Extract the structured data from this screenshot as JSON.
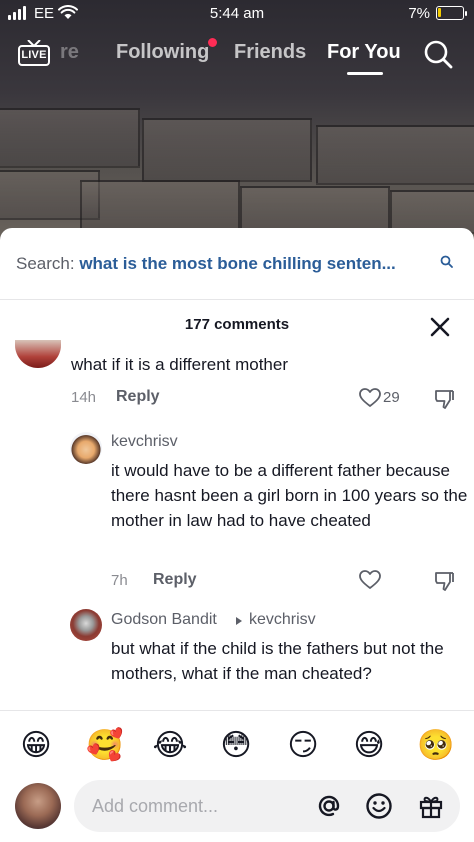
{
  "status": {
    "carrier": "EE",
    "time": "5:44 am",
    "battery": "7%"
  },
  "nav": {
    "live_label": "LIVE",
    "tabs": [
      {
        "label": "re"
      },
      {
        "label": "Following"
      },
      {
        "label": "Friends"
      },
      {
        "label": "For You"
      }
    ],
    "active_tab": "For You"
  },
  "search": {
    "label": "Search:",
    "query": "what is the most bone chilling senten..."
  },
  "comments_header": "177 comments",
  "comments": [
    {
      "text": "what if it is a different mother",
      "time": "14h",
      "reply_label": "Reply",
      "likes": "29"
    },
    {
      "username": "kevchrisv",
      "text": "it would have to be a different father because there hasnt been a girl born in 100 years so the mother in law had to have cheated",
      "time": "7h",
      "reply_label": "Reply"
    },
    {
      "username": "Godson Bandit",
      "reply_to": "kevchrisv",
      "text": "but what if the child is the fathers but not the mothers, what if the man cheated?"
    }
  ],
  "emojis": [
    "😁",
    "🥰",
    "😂",
    "😳",
    "😏",
    "😅",
    "🥺"
  ],
  "input": {
    "placeholder": "Add comment..."
  },
  "colors": {
    "accent_red": "#fe2c55",
    "search_query": "#2b5d98",
    "text_primary": "#161823",
    "text_secondary": "#8a8b91"
  }
}
